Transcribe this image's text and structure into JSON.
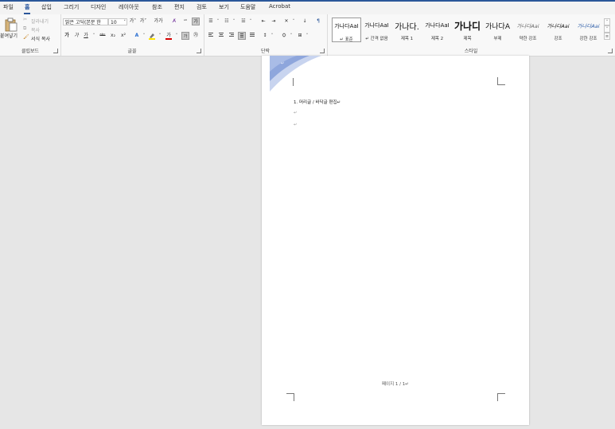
{
  "tabs": [
    "파일",
    "홈",
    "삽입",
    "그리기",
    "디자인",
    "레이아웃",
    "참조",
    "편지",
    "검토",
    "보기",
    "도움말",
    "Acrobat"
  ],
  "active_tab": "홈",
  "clipboard": {
    "paste": "붙여넣기",
    "cut": "잘라내기",
    "copy": "복사",
    "format_painter": "서식 복사",
    "label": "클립보드"
  },
  "font": {
    "family": "맑은 고딕(본문 한",
    "size": "10",
    "grow": "가˄",
    "shrink": "가˅",
    "case": "가가",
    "bold": "가",
    "italic": "가",
    "underline": "가",
    "strike": "ᵃᵇᶜ",
    "subscript": "x₂",
    "superscript": "x²",
    "font_color": "가",
    "char_border": "가",
    "label": "글꼴"
  },
  "paragraph": {
    "label": "단락"
  },
  "styles": {
    "items": [
      {
        "preview": "가나다AaI",
        "name": "↵ 표준"
      },
      {
        "preview": "가나다AaI",
        "name": "↵ 간격 없음"
      },
      {
        "preview": "가나다.",
        "name": "제목 1"
      },
      {
        "preview": "가나다AaI",
        "name": "제목 2"
      },
      {
        "preview": "가나디",
        "name": "제목"
      },
      {
        "preview": "가나다A",
        "name": "부제"
      },
      {
        "preview": "가나다Aai",
        "name": "약한 강조"
      },
      {
        "preview": "가나다Aai",
        "name": "강조"
      },
      {
        "preview": "가나다Aai",
        "name": "강한 강조"
      }
    ],
    "label": "스타일"
  },
  "document": {
    "header_mark": "↵",
    "cursor": "|",
    "list_item": "1. 머리글 / 바닥글 편집↵",
    "mark1": "↵",
    "mark2": "↵",
    "footer": "페이지 1 / 1↵"
  },
  "colors": {
    "accent": "#2b579a",
    "highlight": "#ffe400",
    "font_color": "#d40000",
    "header_art": "#8ea6dc"
  }
}
